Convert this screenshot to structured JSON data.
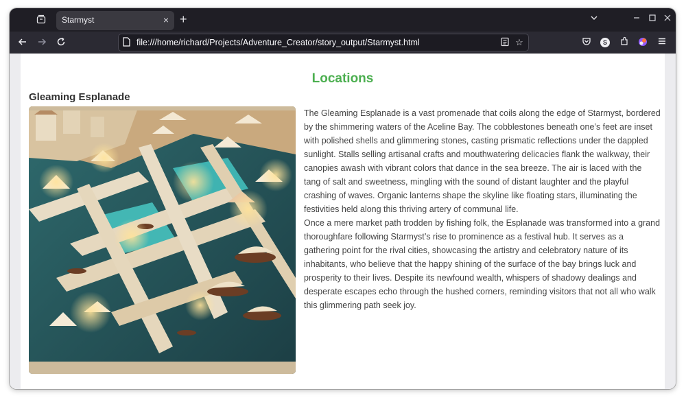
{
  "browser": {
    "tab_title": "Starmyst",
    "url": "file:///home/richard/Projects/Adventure_Creator/story_output/Starmyst.html",
    "profile_initial": "S"
  },
  "page": {
    "heading": "Locations",
    "accent_color": "#4caf50",
    "locations": [
      {
        "name": "Gleaming Esplanade",
        "paragraphs": [
          "The Gleaming Esplanade is a vast promenade that coils along the edge of Starmyst, bordered by the shimmering waters of the Aceline Bay. The cobblestones beneath one’s feet are inset with polished shells and glimmering stones, casting prismatic reflections under the dappled sunlight. Stalls selling artisanal crafts and mouthwatering delicacies flank the walkway, their canopies awash with vibrant colors that dance in the sea breeze. The air is laced with the tang of salt and sweetness, mingling with the sound of distant laughter and the playful crashing of waves. Organic lanterns shape the skyline like floating stars, illuminating the festivities held along this thriving artery of communal life.",
          "Once a mere market path trodden by fishing folk, the Esplanade was transformed into a grand thoroughfare following Starmyst’s rise to prominence as a festival hub. It serves as a gathering point for the rival cities, showcasing the artistry and celebratory nature of its inhabitants, who believe that the happy shining of the surface of the bay brings luck and prosperity to their lives. Despite its newfound wealth, whispers of shadowy dealings and desperate escapes echo through the hushed corners, reminding visitors that not all who walk this glimmering path seek joy."
        ]
      }
    ]
  }
}
